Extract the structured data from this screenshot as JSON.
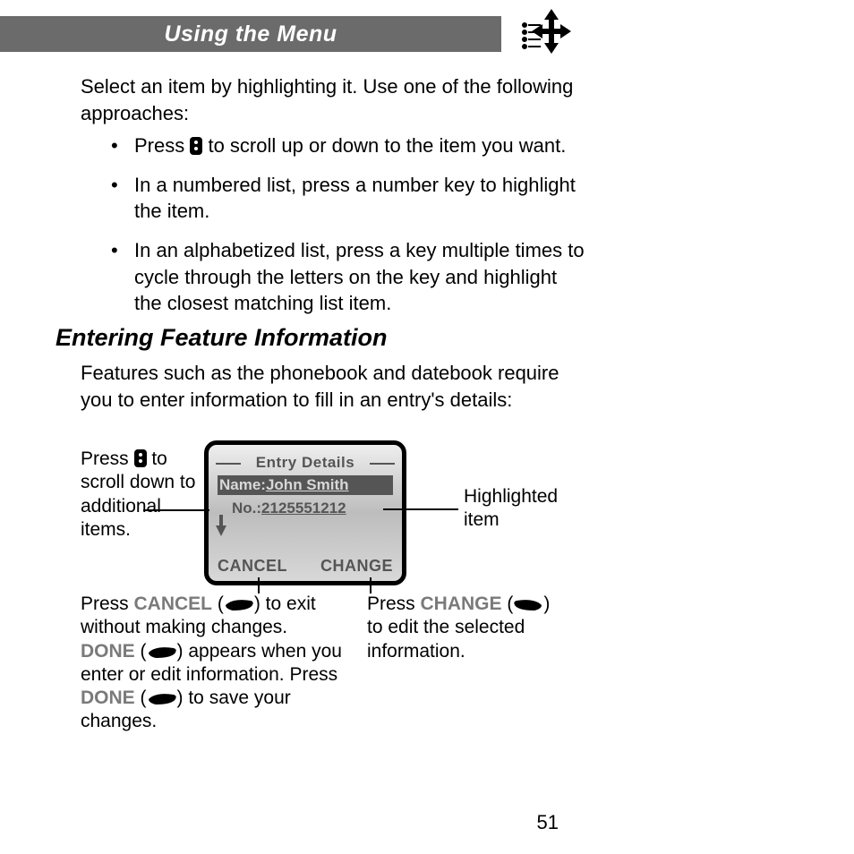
{
  "banner": {
    "title": "Using the Menu"
  },
  "intro": "Select an item by highlighting it. Use one of the following approaches:",
  "bullets": {
    "b1a": "Press ",
    "b1b": " to scroll up or down to the item you want.",
    "b2": "In a numbered list, press a number key to highlight the item.",
    "b3": "In an alphabetized list, press a key multiple times to cycle through the letters on the key and highlight the closest matching list item."
  },
  "section": {
    "heading": "Entering Feature Information",
    "text": "Features such as the phonebook and datebook require you to enter information to fill in an entry's details:"
  },
  "phone": {
    "title": "Entry Details",
    "name_label": "Name:",
    "name_value": "John Smith",
    "no_label": "No.:",
    "no_value": "2125551212",
    "left_softkey": "CANCEL",
    "right_softkey": "CHANGE"
  },
  "callouts": {
    "scroll_a": "Press ",
    "scroll_b": " to scroll down to additional items.",
    "highlight": "Highlighted item",
    "cancel_a": "Press ",
    "cancel_sk1": "CANCEL",
    "cancel_b": " (",
    "cancel_c": ") to exit without making changes.",
    "done_sk": "DONE",
    "cancel_d": " (",
    "cancel_e": ") appears when you enter or edit information. Press ",
    "cancel_f": " (",
    "cancel_g": ") to save your changes.",
    "change_a": "Press ",
    "change_sk": "CHANGE",
    "change_b": " (",
    "change_c": ") to edit the selected information."
  },
  "page_number": "51"
}
